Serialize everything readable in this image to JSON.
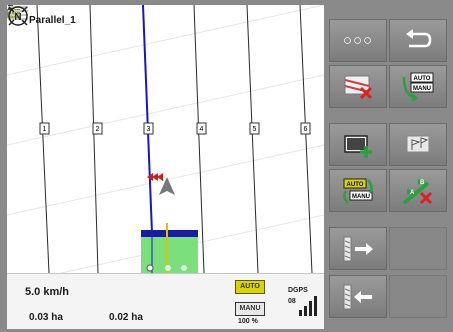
{
  "map": {
    "title": "Parallel_1",
    "track_labels": [
      "1",
      "2",
      "3",
      "4",
      "5",
      "6"
    ],
    "icons": [
      "field-icon",
      "menu-lines-icon",
      "compass-north-icon",
      "tractor-arrow-icon",
      "implement-icon"
    ]
  },
  "status": {
    "speed": "5.0 km/h",
    "area_worked": "0.03 ha",
    "area_total": "0.02 ha",
    "mode_auto": "AUTO",
    "mode_manu": "MANU",
    "mode_percent": "100 %",
    "gps_type": "DGPS",
    "gps_satellites": "08"
  },
  "buttons": {
    "more_label": "○○○",
    "icons": [
      "more-dots-icon",
      "back-arrow-icon",
      "delete-field-icon",
      "auto-manu-icon",
      "add-boundary-icon",
      "ab-flag-icon",
      "auto-manu-toggle-icon",
      "delete-ab-line-icon",
      "shift-track-right-icon",
      "empty",
      "shift-track-left-icon",
      "empty"
    ]
  },
  "colors": {
    "guide_line": "#1616c8",
    "implement": "#7be07b",
    "implement_bar": "#1a1aa8",
    "mode_auto": "#d9d300"
  }
}
